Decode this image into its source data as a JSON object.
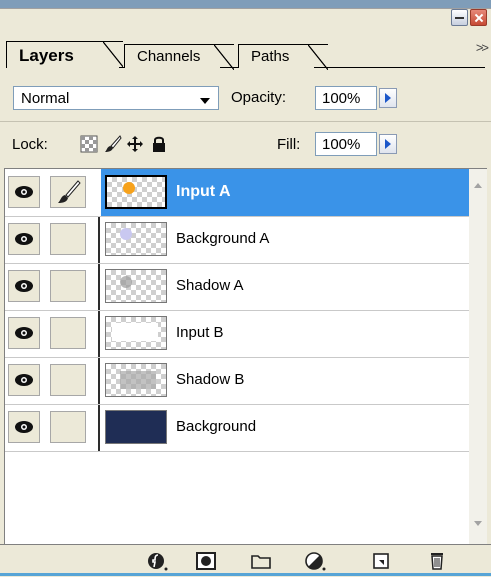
{
  "tabs": {
    "layers": "Layers",
    "channels": "Channels",
    "paths": "Paths",
    "more": ">>"
  },
  "blend": {
    "mode": "Normal",
    "opacity_label": "Opacity:",
    "opacity_value": "100%"
  },
  "lock": {
    "label": "Lock:",
    "fill_label": "Fill:",
    "fill_value": "100%"
  },
  "layers": [
    {
      "name": "Input A",
      "selected": true
    },
    {
      "name": "Background A",
      "selected": false
    },
    {
      "name": "Shadow A",
      "selected": false
    },
    {
      "name": "Input B",
      "selected": false
    },
    {
      "name": "Shadow B",
      "selected": false
    },
    {
      "name": "Background",
      "selected": false
    }
  ],
  "colors": {
    "selection": "#3a93e8",
    "panel": "#ece9d8",
    "accent_orange": "#f7a21b"
  },
  "icons": {
    "window": [
      "minimize-icon",
      "close-icon"
    ],
    "lock": [
      "lock-transparent-icon",
      "lock-paint-icon",
      "lock-move-icon",
      "lock-all-icon"
    ],
    "layer_row": [
      "eye-icon",
      "brush-icon"
    ],
    "toolbar": [
      "layer-style-icon",
      "layer-mask-icon",
      "new-group-icon",
      "adjustment-layer-icon",
      "new-layer-icon",
      "delete-layer-icon"
    ]
  }
}
